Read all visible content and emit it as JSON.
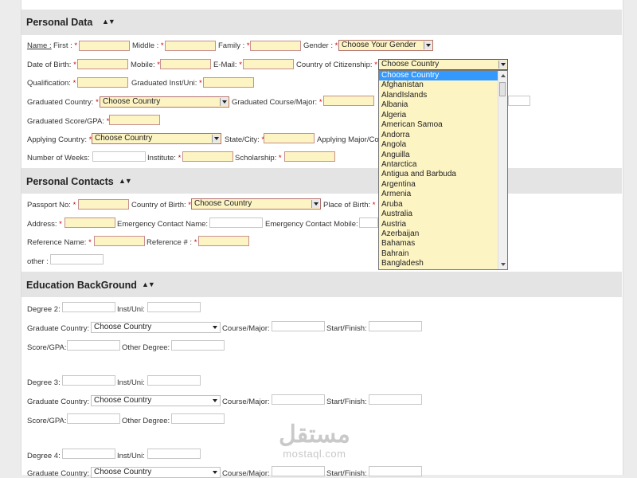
{
  "sections": {
    "personal_data": "Personal Data",
    "personal_contacts": "Personal Contacts",
    "education": "Education BackGround",
    "toggle": "▲▼"
  },
  "personal": {
    "name": "Name :",
    "first": "First :",
    "middle": "Middle :",
    "family": "Family :",
    "gender": "Gender :",
    "gender_value": "Choose Your Gender",
    "dob": "Date of Birth:",
    "mobile": "Mobile:",
    "email": "E-Mail:",
    "citizenship": "Country of Citizenship:",
    "citizenship_value": "Choose Country",
    "qualification": "Qualification:",
    "grad_inst": "Graduated Inst/Uni:",
    "grad_country": "Graduated Country:",
    "grad_country_value": "Choose Country",
    "grad_course": "Graduated Course/Major:",
    "grad_score": "Graduated Score/GPA:",
    "applying_country": "Applying Country:",
    "applying_country_value": "Choose Country",
    "state_city": "State/City:",
    "applying_major": "Applying Major/Co",
    "weeks": "Number of Weeks:",
    "institute": "Institute:",
    "scholarship": "Scholarship:",
    "req": "*"
  },
  "contacts": {
    "passport": "Passport No:",
    "country_birth": "Country of Birth:",
    "country_birth_value": "Choose Country",
    "place_birth": "Place of Birth:",
    "address": "Address:",
    "emergency_name": "Emergency Contact Name:",
    "emergency_mobile": "Emergency Contact Mobile:",
    "ref_name": "Reference Name:",
    "ref_no": "Reference # :",
    "other": "other :"
  },
  "education": {
    "degree2": "Degree 2:",
    "degree3": "Degree 3:",
    "degree4": "Degree 4:",
    "inst": "Inst/Uni:",
    "grad_country": "Graduate Country:",
    "country_value": "Choose Country",
    "course": "Course/Major:",
    "start": "Start/Finish:",
    "score": "Score/GPA:",
    "other": "Other Degree:"
  },
  "dropdown": {
    "options": [
      "Choose Country",
      "Afghanistan",
      "AlandIslands",
      "Albania",
      "Algeria",
      "American Samoa",
      "Andorra",
      "Angola",
      "Anguilla",
      "Antarctica",
      "Antigua and Barbuda",
      "Argentina",
      "Armenia",
      "Aruba",
      "Australia",
      "Austria",
      "Azerbaijan",
      "Bahamas",
      "Bahrain",
      "Bangladesh"
    ],
    "selected": "Choose Country"
  },
  "watermark": {
    "arabic": "مستقل",
    "latin": "mostaql.com"
  }
}
